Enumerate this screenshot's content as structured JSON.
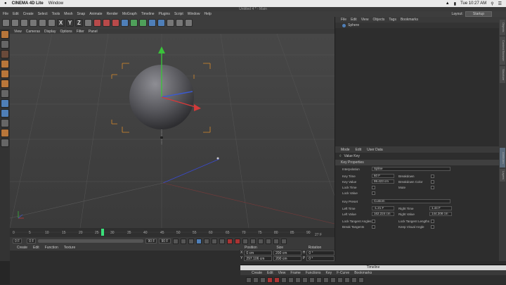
{
  "mac_menu": {
    "app": "CINEMA 4D Lite",
    "items": [
      "Window"
    ],
    "time": "Tue 10:27 AM"
  },
  "window_title": "Untitled 4 * - Main",
  "menubar": {
    "items": [
      "File",
      "Edit",
      "Create",
      "Select",
      "Tools",
      "Mesh",
      "Snap",
      "Animate",
      "Render",
      "MoGraph",
      "Timeline",
      "Plugins",
      "Script",
      "Window",
      "Help"
    ],
    "layout_label": "Layout:",
    "layout_value": "Startup"
  },
  "viewport_menu": [
    "View",
    "Cameras",
    "Display",
    "Options",
    "Filter",
    "Panel"
  ],
  "timeline": {
    "ticks": [
      "0",
      "5",
      "10",
      "15",
      "20",
      "25",
      "30",
      "35",
      "40",
      "45",
      "50",
      "55",
      "60",
      "65",
      "70",
      "75",
      "80",
      "85",
      "90"
    ],
    "current_frame": "27 F",
    "start": "0 F",
    "min": "0 F",
    "max": "90 F",
    "end": "90 F"
  },
  "material_menu": [
    "Create",
    "Edit",
    "Function",
    "Texture"
  ],
  "coords": {
    "headers": [
      "Position",
      "Size",
      "Rotation"
    ],
    "rows": [
      {
        "axis": "X",
        "pos": "0 cm",
        "size": "200 cm",
        "rax": "H",
        "rot": "0 °"
      },
      {
        "axis": "Y",
        "pos": "297.106 cm",
        "size": "200 cm",
        "rax": "P",
        "rot": "0 °"
      }
    ]
  },
  "object_menu": [
    "File",
    "Edit",
    "View",
    "Objects",
    "Tags",
    "Bookmarks"
  ],
  "object_item": "Sphere",
  "attr_menu": [
    "Mode",
    "Edit",
    "User Data"
  ],
  "attr_mode": "Value Key",
  "attr_tab": "Key Properties",
  "attr": {
    "interpolation_label": "Interpolation",
    "interpolation_value": "Spline",
    "key_time_label": "Key Time",
    "key_time": "60 F",
    "key_value_label": "Key Value",
    "key_value": "99.423 cm",
    "breakdown_label": "Breakdown",
    "breakdown_color_label": "Breakdown Color",
    "mute_label": "Mute",
    "lock_time_label": "Lock Time",
    "lock_value_label": "Lock Value",
    "preset_label": "Key Preset",
    "preset_value": "Custom",
    "left_time_label": "Left Time",
    "left_time": "-1.21 F",
    "right_time_label": "Right Time",
    "right_time": "1.44 F",
    "left_value_label": "Left Value",
    "left_value": "162.224 cm",
    "right_value_label": "Right Value",
    "right_value": "144.208 cm",
    "lock_tangent_angles_label": "Lock Tangent Angles",
    "lock_tangent_lengths_label": "Lock Tangent Lengths",
    "break_tangents_label": "Break Tangents",
    "keep_visual_angle_label": "Keep Visual Angle"
  },
  "right_tabs": [
    "Objects",
    "Content Browser",
    "Structure",
    "Attributes",
    "Layers"
  ],
  "timeline_window": {
    "title": "Timeline",
    "menu": [
      "Create",
      "Edit",
      "View",
      "Frame",
      "Functions",
      "Key",
      "F-Curve",
      "Bookmarks"
    ]
  },
  "colors": {
    "accent": "#4f7fb8",
    "x_axis": "#d23a3a",
    "y_axis": "#3ac23a",
    "z_axis": "#3a5ad2",
    "bbox": "#d88a2a",
    "playhead": "#3ae07a"
  }
}
